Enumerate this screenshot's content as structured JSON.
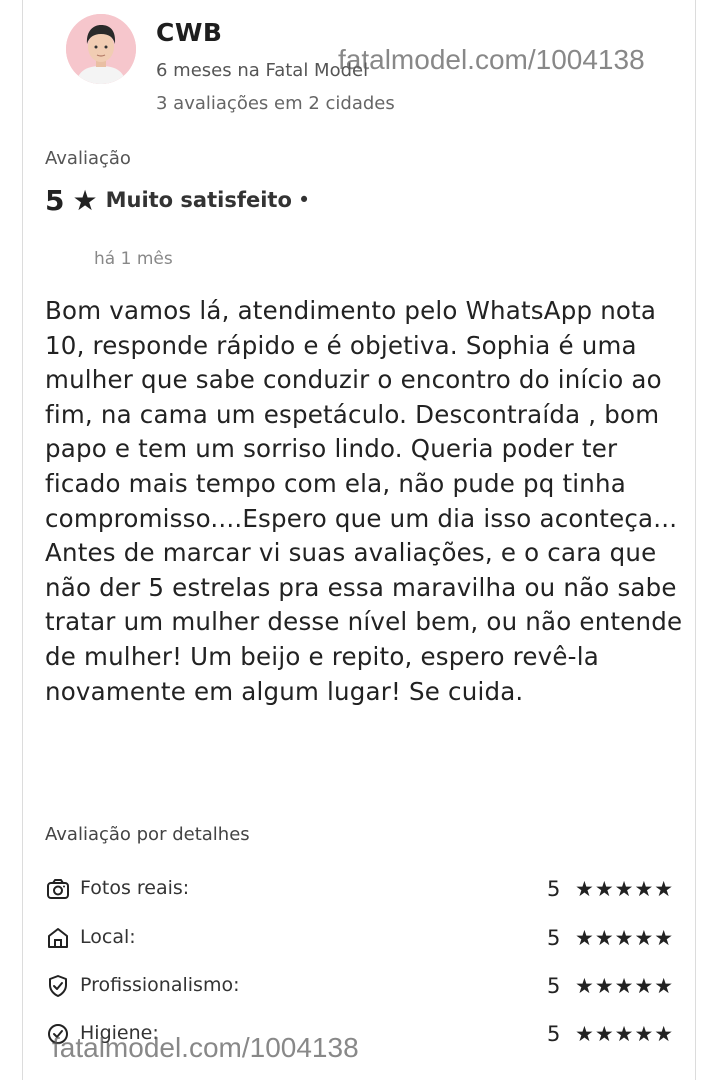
{
  "reviewer": {
    "name": "CWB",
    "tenure": "6 meses na Fatal Model",
    "review_count": "3 avaliações em 2 cidades"
  },
  "watermark": {
    "top": "fatalmodel.com/1004138",
    "bottom": "fatalmodel.com/1004138"
  },
  "rating": {
    "heading": "Avaliação",
    "value": "5",
    "star": "★",
    "label": "Muito satisfeito",
    "separator": "•",
    "date": "há 1 mês"
  },
  "review": {
    "text": "Bom vamos lá, atendimento pelo WhatsApp nota 10, responde rápido e é objetiva. Sophia é uma mulher que sabe conduzir o encontro do início ao fim, na cama um espetáculo. Descontraída , bom papo e tem um sorriso lindo. Queria poder ter ficado mais tempo com ela, não pude pq tinha compromisso....Espero que um dia isso aconteça... Antes de marcar vi suas avaliações, e o cara que não der 5 estrelas pra essa maravilha ou não sabe tratar um mulher desse nível bem, ou não entende de mulher! Um beijo e repito, espero revê-la novamente em algum lugar! Se cuida."
  },
  "details": {
    "heading": "Avaliação por detalhes",
    "items": [
      {
        "icon": "camera-icon",
        "label": "Fotos reais:",
        "score": "5",
        "stars": "★★★★★"
      },
      {
        "icon": "home-icon",
        "label": "Local:",
        "score": "5",
        "stars": "★★★★★"
      },
      {
        "icon": "shield-check-icon",
        "label": "Profissionalismo:",
        "score": "5",
        "stars": "★★★★★"
      },
      {
        "icon": "check-circle-icon",
        "label": "Higiene:",
        "score": "5",
        "stars": "★★★★★"
      }
    ]
  },
  "colors": {
    "avatar_background": "#f6c6cc",
    "text": "#222222",
    "muted_text": "#666666"
  }
}
